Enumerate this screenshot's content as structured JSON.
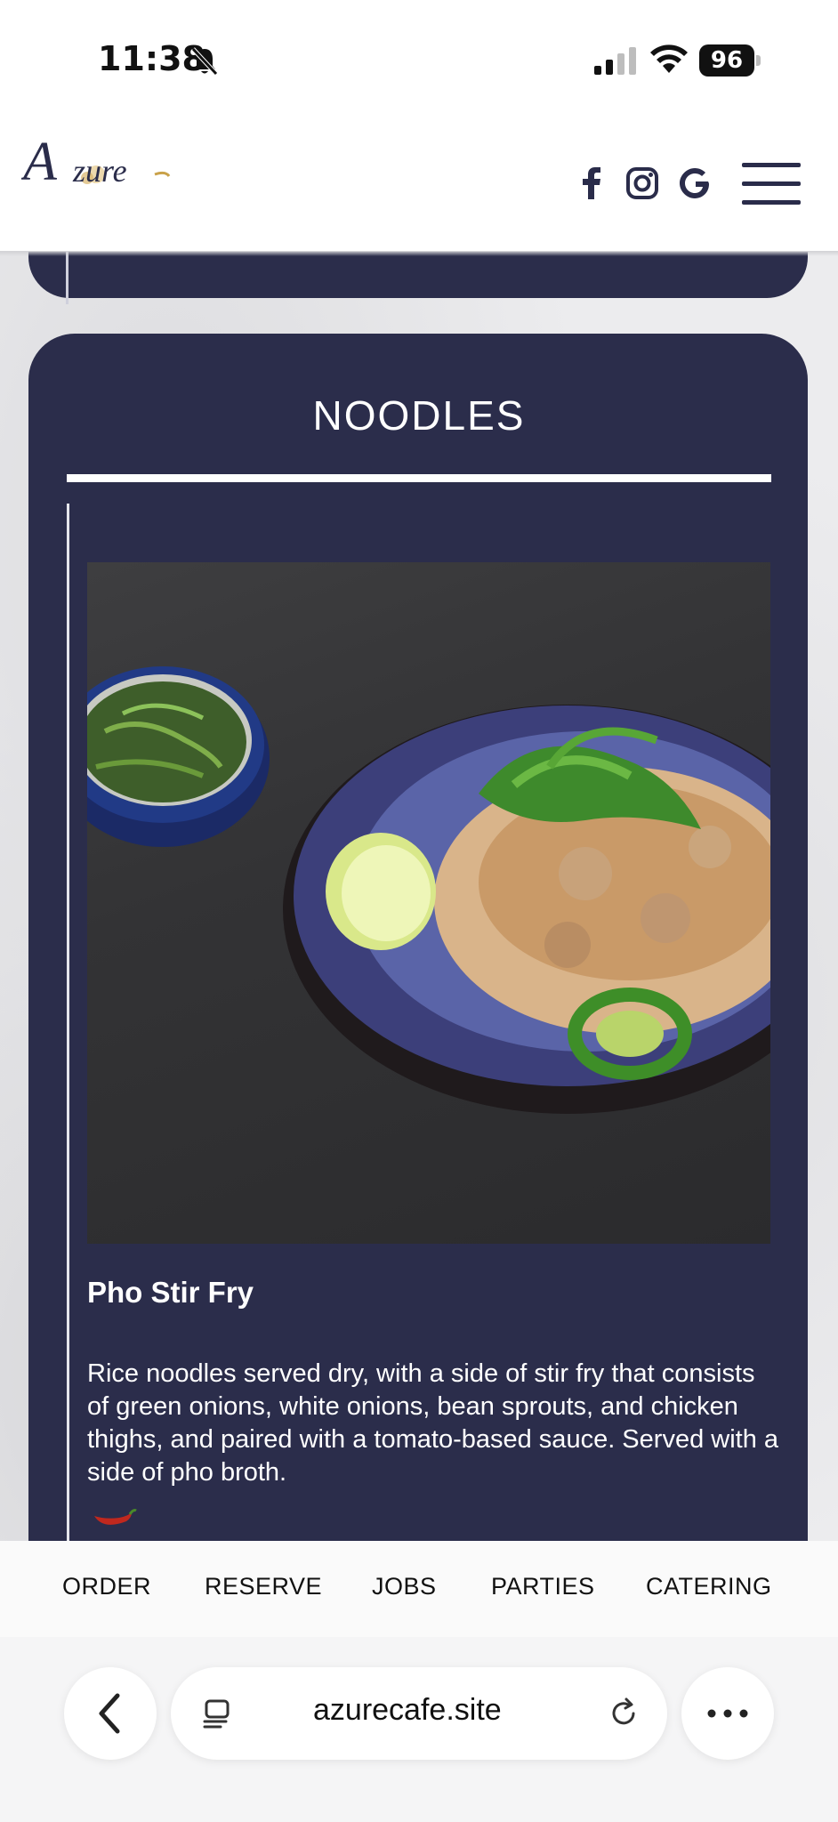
{
  "status_bar": {
    "time": "11:38",
    "battery": "96",
    "icons": [
      "bell-slash-icon",
      "signal-icon",
      "wifi-icon",
      "battery-icon"
    ]
  },
  "header": {
    "logo_text": "Azure",
    "social_icons": [
      "facebook-icon",
      "instagram-icon",
      "google-icon"
    ],
    "menu_icon": "hamburger-menu-icon"
  },
  "section": {
    "title": "NOODLES",
    "item": {
      "name": "Pho Stir Fry",
      "description": "Rice noodles served dry, with a side of stir fry that consists of green onions, white onions, bean sprouts, and chicken thighs, and paired with a tomato-based sauce. Served with a side of pho broth.",
      "spice_icon": "chili-pepper-icon"
    }
  },
  "bottom_nav": {
    "items": [
      "ORDER",
      "RESERVE",
      "JOBS",
      "PARTIES",
      "CATERING"
    ]
  },
  "browser": {
    "url": "azurecafe.site",
    "back_icon": "chevron-left-icon",
    "tabs_icon": "reader-icon",
    "reload_icon": "reload-icon",
    "more_icon": "more-icon"
  },
  "colors": {
    "card": "#2b2d4b",
    "accent_gold": "#c9a24a",
    "chili": "#c0281e"
  }
}
